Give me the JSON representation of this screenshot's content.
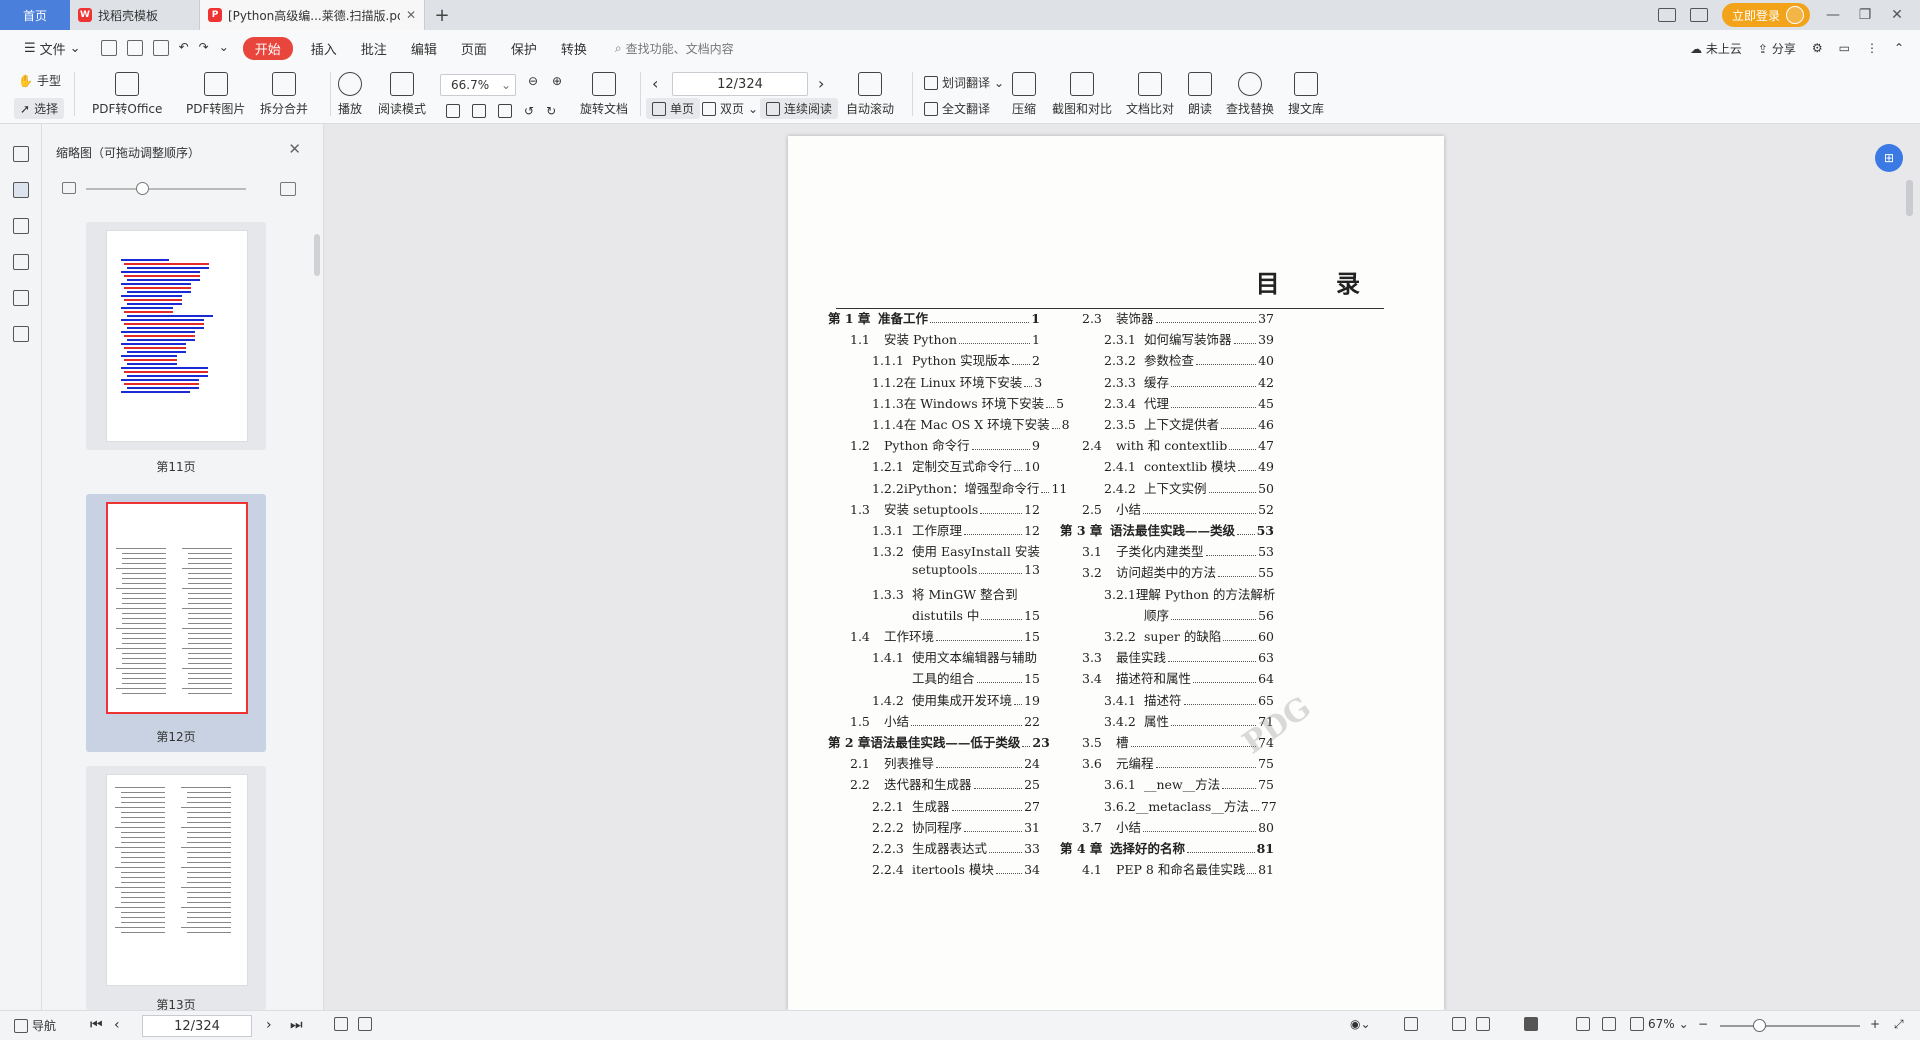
{
  "tabs": {
    "home": "首页",
    "template": "找稻壳模板",
    "document": "[Python高级编...莱德.扫描版.pdf",
    "login": "立即登录"
  },
  "menu": {
    "file": "文件",
    "items": [
      "开始",
      "插入",
      "批注",
      "编辑",
      "页面",
      "保护",
      "转换"
    ],
    "search_placeholder": "查找功能、文档内容",
    "cloud": "未上云",
    "share": "分享"
  },
  "toolbar": {
    "hand": "手型",
    "select": "选择",
    "pdf_to_office": "PDF转Office",
    "pdf_to_image": "PDF转图片",
    "split_merge": "拆分合并",
    "play": "播放",
    "reading_mode": "阅读模式",
    "zoom": "66.7%",
    "rotate": "旋转文档",
    "page": "12/324",
    "single": "单页",
    "double": "双页",
    "continuous": "连续阅读",
    "auto_scroll": "自动滚动",
    "word_translate": "划词翻译",
    "full_translate": "全文翻译",
    "compress": "压缩",
    "screenshot_compare": "截图和对比",
    "compare": "文档比对",
    "read_aloud": "朗读",
    "find_replace": "查找替换",
    "search_lib": "搜文库"
  },
  "sidebar": {
    "title": "缩略图（可拖动调整顺序）",
    "thumbs": [
      "第11页",
      "第12页",
      "第13页"
    ],
    "slider_value": 0.35
  },
  "document": {
    "title": "目 录",
    "left": [
      {
        "num": "第 1 章",
        "title": "准备工作",
        "page": "1",
        "level": 0
      },
      {
        "num": "1.1",
        "title": "安装 Python",
        "page": "1",
        "level": 1
      },
      {
        "num": "1.1.1",
        "title": "Python 实现版本",
        "page": "2",
        "level": 2
      },
      {
        "num": "1.1.2",
        "title": "在 Linux 环境下安装",
        "page": "3",
        "level": 2
      },
      {
        "num": "1.1.3",
        "title": "在 Windows 环境下安装",
        "page": "5",
        "level": 2
      },
      {
        "num": "1.1.4",
        "title": "在 Mac OS X 环境下安装",
        "page": "8",
        "level": 2
      },
      {
        "num": "1.2",
        "title": "Python 命令行",
        "page": "9",
        "level": 1
      },
      {
        "num": "1.2.1",
        "title": "定制交互式命令行",
        "page": "10",
        "level": 2
      },
      {
        "num": "1.2.2",
        "title": "iPython：增强型命令行",
        "page": "11",
        "level": 2
      },
      {
        "num": "1.3",
        "title": "安装 setuptools",
        "page": "12",
        "level": 1
      },
      {
        "num": "1.3.1",
        "title": "工作原理",
        "page": "12",
        "level": 2
      },
      {
        "num": "1.3.2",
        "title": "使用 EasyInstall 安装",
        "page": "",
        "level": 2
      },
      {
        "num": "",
        "title": "setuptools",
        "page": "13",
        "level": 2
      },
      {
        "num": "1.3.3",
        "title": "将 MinGW 整合到",
        "page": "",
        "level": 2
      },
      {
        "num": "",
        "title": "distutils 中",
        "page": "15",
        "level": 2
      },
      {
        "num": "1.4",
        "title": "工作环境",
        "page": "15",
        "level": 1
      },
      {
        "num": "1.4.1",
        "title": "使用文本编辑器与辅助",
        "page": "",
        "level": 2
      },
      {
        "num": "",
        "title": "工具的组合",
        "page": "15",
        "level": 2
      },
      {
        "num": "1.4.2",
        "title": "使用集成开发环境",
        "page": "19",
        "level": 2
      },
      {
        "num": "1.5",
        "title": "小结",
        "page": "22",
        "level": 1
      },
      {
        "num": "第 2 章",
        "title": "语法最佳实践——低于类级",
        "page": "23",
        "level": 0
      },
      {
        "num": "2.1",
        "title": "列表推导",
        "page": "24",
        "level": 1
      },
      {
        "num": "2.2",
        "title": "迭代器和生成器",
        "page": "25",
        "level": 1
      },
      {
        "num": "2.2.1",
        "title": "生成器",
        "page": "27",
        "level": 2
      },
      {
        "num": "2.2.2",
        "title": "协同程序",
        "page": "31",
        "level": 2
      },
      {
        "num": "2.2.3",
        "title": "生成器表达式",
        "page": "33",
        "level": 2
      },
      {
        "num": "2.2.4",
        "title": "itertools 模块",
        "page": "34",
        "level": 2
      }
    ],
    "right": [
      {
        "num": "2.3",
        "title": "装饰器",
        "page": "37",
        "level": 1
      },
      {
        "num": "2.3.1",
        "title": "如何编写装饰器",
        "page": "39",
        "level": 2
      },
      {
        "num": "2.3.2",
        "title": "参数检查",
        "page": "40",
        "level": 2
      },
      {
        "num": "2.3.3",
        "title": "缓存",
        "page": "42",
        "level": 2
      },
      {
        "num": "2.3.4",
        "title": "代理",
        "page": "45",
        "level": 2
      },
      {
        "num": "2.3.5",
        "title": "上下文提供者",
        "page": "46",
        "level": 2
      },
      {
        "num": "2.4",
        "title": "with 和 contextlib",
        "page": "47",
        "level": 1
      },
      {
        "num": "2.4.1",
        "title": "contextlib 模块",
        "page": "49",
        "level": 2
      },
      {
        "num": "2.4.2",
        "title": "上下文实例",
        "page": "50",
        "level": 2
      },
      {
        "num": "2.5",
        "title": "小结",
        "page": "52",
        "level": 1
      },
      {
        "num": "第 3 章",
        "title": "语法最佳实践——类级",
        "page": "53",
        "level": 0
      },
      {
        "num": "3.1",
        "title": "子类化内建类型",
        "page": "53",
        "level": 1
      },
      {
        "num": "3.2",
        "title": "访问超类中的方法",
        "page": "55",
        "level": 1
      },
      {
        "num": "3.2.1",
        "title": "理解 Python 的方法解析",
        "page": "",
        "level": 2
      },
      {
        "num": "",
        "title": "顺序",
        "page": "56",
        "level": 2
      },
      {
        "num": "3.2.2",
        "title": "super 的缺陷",
        "page": "60",
        "level": 2
      },
      {
        "num": "3.3",
        "title": "最佳实践",
        "page": "63",
        "level": 1
      },
      {
        "num": "3.4",
        "title": "描述符和属性",
        "page": "64",
        "level": 1
      },
      {
        "num": "3.4.1",
        "title": "描述符",
        "page": "65",
        "level": 2
      },
      {
        "num": "3.4.2",
        "title": "属性",
        "page": "71",
        "level": 2
      },
      {
        "num": "3.5",
        "title": "槽",
        "page": "74",
        "level": 1
      },
      {
        "num": "3.6",
        "title": "元编程",
        "page": "75",
        "level": 1
      },
      {
        "num": "3.6.1",
        "title": "__new__方法",
        "page": "75",
        "level": 2
      },
      {
        "num": "3.6.2",
        "title": "__metaclass__方法",
        "page": "77",
        "level": 2
      },
      {
        "num": "3.7",
        "title": "小结",
        "page": "80",
        "level": 1
      },
      {
        "num": "第 4 章",
        "title": "选择好的名称",
        "page": "81",
        "level": 0
      },
      {
        "num": "4.1",
        "title": "PEP 8 和命名最佳实践",
        "page": "81",
        "level": 1
      }
    ]
  },
  "statusbar": {
    "nav": "导航",
    "page": "12/324",
    "zoom": "67%",
    "zoom_slider_value": 0.28
  },
  "colors": {
    "accent_red": "#e8453c",
    "tab_blue": "#4a7fdc",
    "login_orange": "#f2a31a"
  }
}
